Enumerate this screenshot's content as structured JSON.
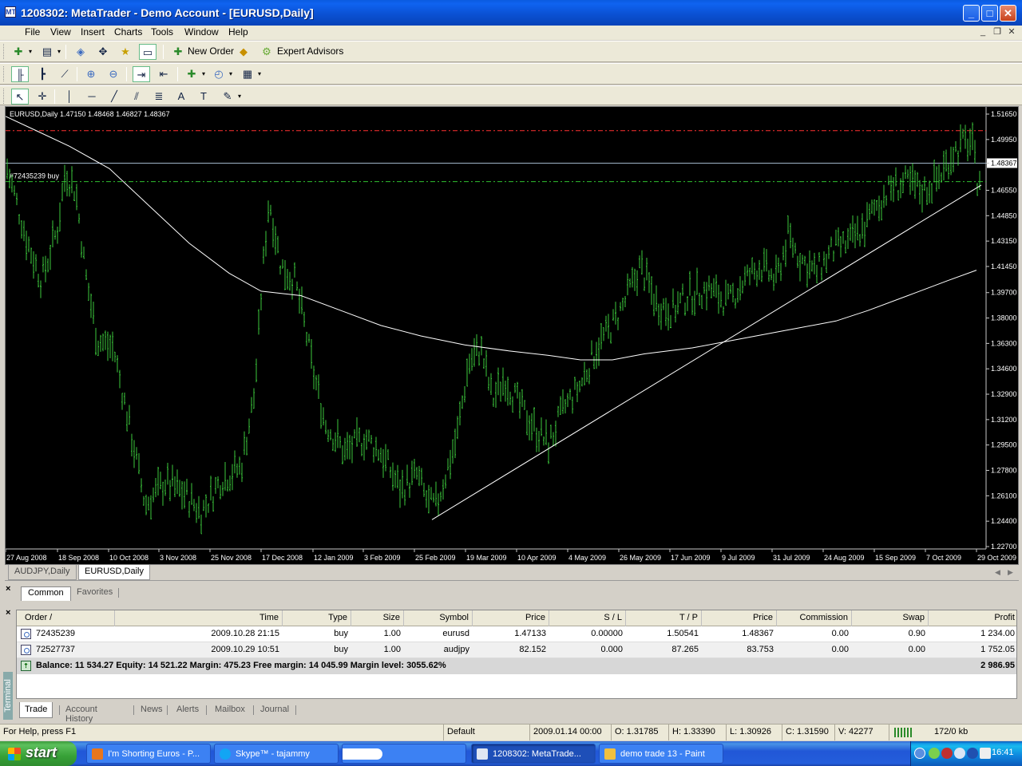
{
  "window": {
    "title": "1208302: MetaTrader - Demo Account - [EURUSD,Daily]",
    "app_icon": "MT",
    "minimize_glyph": "_",
    "maximize_glyph": "□",
    "close_glyph": "✕"
  },
  "menu": [
    "File",
    "View",
    "Insert",
    "Charts",
    "Tools",
    "Window",
    "Help"
  ],
  "mdi_controls": [
    "_",
    "❐",
    "✕"
  ],
  "toolbar1": {
    "new_order_label": "New Order",
    "expert_advisors_label": "Expert Advisors"
  },
  "chart": {
    "symbol_info": "EURUSD,Daily  1.47150 1.48468 1.46827 1.48367",
    "order_label": "#72435239 buy",
    "current_price": "1.48367",
    "price_ticks": [
      "1.51650",
      "1.49950",
      "1.48367",
      "1.46550",
      "1.44850",
      "1.43150",
      "1.41450",
      "1.39700",
      "1.38000",
      "1.36300",
      "1.34600",
      "1.32900",
      "1.31200",
      "1.29500",
      "1.27800",
      "1.26100",
      "1.24400",
      "1.22700"
    ],
    "date_ticks": [
      "27 Aug 2008",
      "18 Sep 2008",
      "10 Oct 2008",
      "3 Nov 2008",
      "25 Nov 2008",
      "17 Dec 2008",
      "12 Jan 2009",
      "3 Feb 2009",
      "25 Feb 2009",
      "19 Mar 2009",
      "10 Apr 2009",
      "4 May 2009",
      "26 May 2009",
      "17 Jun 2009",
      "9 Jul 2009",
      "31 Jul 2009",
      "24 Aug 2009",
      "15 Sep 2009",
      "7 Oct 2009",
      "29 Oct 2009"
    ],
    "colors": {
      "background": "#000000",
      "bars": "#3CC83C",
      "moving_average": "#FFFFFF",
      "take_profit_line": "#FF3030",
      "open_price_line": "#30C030",
      "bid_line": "#A0B4C8"
    }
  },
  "chart_tabs": [
    "AUDJPY,Daily",
    "EURUSD,Daily"
  ],
  "terminal": {
    "close_glyph": "×",
    "side_label": "Terminal",
    "filter_tabs": [
      "Common",
      "Favorites"
    ],
    "columns": [
      "Order  /",
      "Time",
      "Type",
      "Size",
      "Symbol",
      "Price",
      "S / L",
      "T / P",
      "Price",
      "Commission",
      "Swap",
      "Profit"
    ],
    "rows": [
      [
        "72435239",
        "2009.10.28 21:15",
        "buy",
        "1.00",
        "eurusd",
        "1.47133",
        "0.00000",
        "1.50541",
        "1.48367",
        "0.00",
        "0.90",
        "1 234.00"
      ],
      [
        "72527737",
        "2009.10.29 10:51",
        "buy",
        "1.00",
        "audjpy",
        "82.152",
        "0.000",
        "87.265",
        "83.753",
        "0.00",
        "0.00",
        "1 752.05"
      ]
    ],
    "summary": "Balance: 11 534.27  Equity: 14 521.22  Margin: 475.23  Free margin: 14 045.99  Margin level: 3055.62%",
    "summary_profit": "2 986.95",
    "tabs": [
      "Trade",
      "Account History",
      "News",
      "Alerts",
      "Mailbox",
      "Journal"
    ]
  },
  "status": {
    "help": "For Help, press F1",
    "profile": "Default",
    "datetime": "2009.01.14 00:00",
    "open": "O: 1.31785",
    "high": "H: 1.33390",
    "low": "L: 1.30926",
    "close": "C: 1.31590",
    "volume": "V: 42277",
    "traffic": "172/0 kb"
  },
  "taskbar": {
    "start_label": "start",
    "tasks": [
      "I'm Shorting Euros - P...",
      "Skype™ - tajammy",
      "",
      "1208302: MetaTrade...",
      "demo trade 13 - Paint"
    ],
    "clock": "16:41"
  }
}
